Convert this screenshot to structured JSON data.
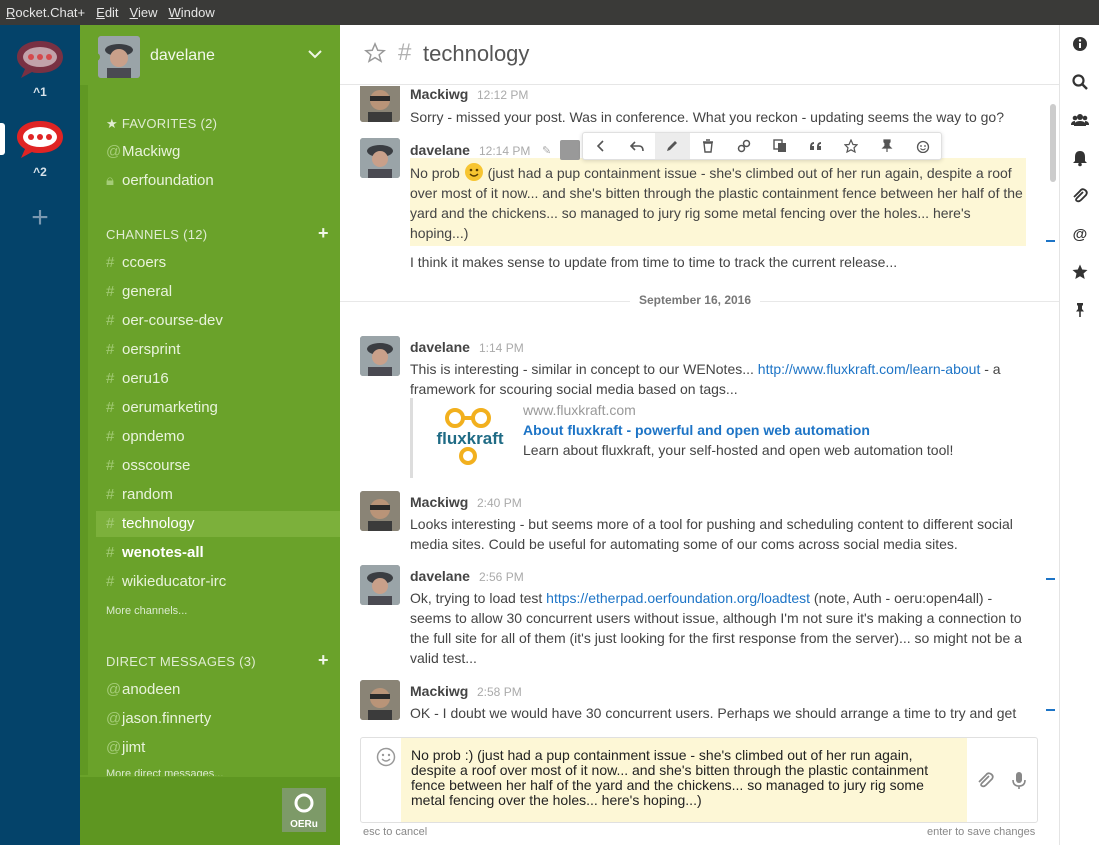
{
  "menubar": {
    "items": [
      "Rocket.Chat+",
      "Edit",
      "View",
      "Window"
    ]
  },
  "servers": [
    {
      "label": "^1"
    },
    {
      "label": "^2"
    }
  ],
  "user": {
    "name": "davelane"
  },
  "sidebar": {
    "favorites_title": "FAVORITES (2)",
    "favorites": [
      "Mackiwg",
      "oerfoundation"
    ],
    "channels_title": "CHANNELS (12)",
    "channels": [
      "ccoers",
      "general",
      "oer-course-dev",
      "oersprint",
      "oeru16",
      "oerumarketing",
      "opndemo",
      "osscourse",
      "random",
      "technology",
      "wenotes-all",
      "wikieducator-irc"
    ],
    "more_channels": "More channels...",
    "dm_title": "DIRECT MESSAGES (3)",
    "dms": [
      "anodeen",
      "jason.finnerty",
      "jimt"
    ],
    "dm_more_partial": "More direct messages...",
    "logo_text": "OERu"
  },
  "room": {
    "name": "technology"
  },
  "messages": [
    {
      "user": "Mackiwg",
      "time": "12:12 PM",
      "text": "Sorry - missed your post. Was in conference. What you reckon - updating seems the way to go?"
    },
    {
      "user": "davelane",
      "time": "12:14 PM",
      "text_a": "No prob ",
      "text_b": " (just had a pup containment issue - she's climbed out of her run again, despite a roof over most of it now... and she's bitten through the plastic containment fence between her half of the yard and the chickens... so managed to jury rig some metal fencing over the holes... here's hoping...)"
    },
    {
      "text": "I think it makes sense to update from time to time to track the current release..."
    },
    {
      "day": "September 16, 2016"
    },
    {
      "user": "davelane",
      "time": "1:14 PM",
      "text_a": "This is interesting - similar in concept to our WENotes... ",
      "link": "http://www.fluxkraft.com/learn-about",
      "text_b": " - a framework for scouring social media based on tags...",
      "preview": {
        "site": "www.fluxkraft.com",
        "title": "About fluxkraft - powerful and open web automation",
        "desc": "Learn about fluxkraft, your self-hosted and open web automation tool!",
        "logo": "fluxkraft"
      }
    },
    {
      "user": "Mackiwg",
      "time": "2:40 PM",
      "text": "Looks interesting - but seems more of a tool for pushing and scheduling content to different social media sites. Could be useful for automating some of our coms across social media sites."
    },
    {
      "user": "davelane",
      "time": "2:56 PM",
      "text_a": "Ok, trying to load test ",
      "link": "https://etherpad.oerfoundation.org/loadtest",
      "text_b": " (note, Auth - oeru:open4all) - seems to allow 30 concurrent users without issue, although I'm not sure it's making a connection to the full site for all of them (it's just looking for the first response from the server)... so might not be a valid test..."
    },
    {
      "user": "Mackiwg",
      "time": "2:58 PM",
      "text": "OK - I doubt we would have 30 concurrent users. Perhaps we should arrange a time to try and get"
    }
  ],
  "composer": {
    "text": "No prob :) (just had a pup containment issue - she's climbed out of her run again, despite a roof over most of it now... and she's bitten through the plastic containment fence between her half of the yard and the chickens...  so managed to jury rig some metal fencing over the holes... here's hoping...)",
    "hint_left": "esc to cancel",
    "hint_right": "enter to save changes"
  },
  "colors": {
    "sidebar": "#6aa22a",
    "servers": "#04436a",
    "link": "#1d74c6",
    "editing": "#fdf7d6"
  }
}
